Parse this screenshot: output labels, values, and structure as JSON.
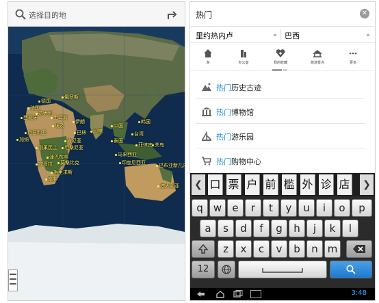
{
  "left": {
    "search_placeholder": "选择目的地",
    "map_labels": [
      {
        "text": "俄罗斯",
        "id": "russia"
      },
      {
        "text": "德国",
        "id": "germany"
      },
      {
        "text": "法国",
        "id": "france"
      },
      {
        "text": "西班牙",
        "id": "spain"
      },
      {
        "text": "意大利",
        "id": "italy"
      },
      {
        "text": "土耳其",
        "id": "turkey"
      },
      {
        "text": "伊朗",
        "id": "iran"
      },
      {
        "text": "埃及",
        "id": "egypt"
      },
      {
        "text": "印度",
        "id": "india"
      },
      {
        "text": "巴林",
        "id": "bahrain"
      },
      {
        "text": "中国",
        "id": "china"
      },
      {
        "text": "韩国",
        "id": "korea"
      },
      {
        "text": "台湾",
        "id": "taiwan"
      },
      {
        "text": "泰国",
        "id": "thailand"
      },
      {
        "text": "菲律宾",
        "id": "philippines"
      },
      {
        "text": "马来西亚",
        "id": "malaysia"
      },
      {
        "text": "印度尼西亚",
        "id": "indonesia"
      },
      {
        "text": "关岛",
        "id": "guam"
      },
      {
        "text": "巴布亚新几内",
        "id": "png"
      },
      {
        "text": "肯尼亚",
        "id": "kenya"
      },
      {
        "text": "坦桑尼亚",
        "id": "tanzania"
      },
      {
        "text": "刚果民主",
        "id": "drc"
      },
      {
        "text": "安哥拉",
        "id": "angola"
      },
      {
        "text": "莫桑比克",
        "id": "mozambique"
      },
      {
        "text": "津巴布韦",
        "id": "zimbabwe"
      },
      {
        "text": "南非",
        "id": "south-africa"
      },
      {
        "text": "毛里求斯",
        "id": "mauritius"
      },
      {
        "text": "澳大利亚",
        "id": "australia"
      },
      {
        "text": "尼日利亚",
        "id": "nigeria"
      },
      {
        "text": "加纳",
        "id": "ghana"
      }
    ]
  },
  "right": {
    "search_query": "热门",
    "location_city": "里约热内卢",
    "location_country": "巴西",
    "categories": [
      {
        "label": "家",
        "icon": "home-icon"
      },
      {
        "label": "办公室",
        "icon": "office-icon"
      },
      {
        "label": "我的收藏",
        "icon": "favorite-icon"
      },
      {
        "label": "旅游景点",
        "icon": "attraction-icon"
      },
      {
        "label": "更多",
        "icon": "more-icon"
      }
    ],
    "results": [
      {
        "highlight": "热门",
        "rest": "历史古迹",
        "icon": "mountain-icon"
      },
      {
        "highlight": "热门",
        "rest": "博物馆",
        "icon": "museum-icon"
      },
      {
        "highlight": "热门",
        "rest": "游乐园",
        "icon": "amusement-icon"
      },
      {
        "highlight": "热门",
        "rest": "购物中心",
        "icon": "cart-icon"
      }
    ],
    "keyboard": {
      "candidates": [
        "口",
        "票",
        "户",
        "前",
        "槛",
        "外",
        "诊",
        "店"
      ],
      "row1": [
        "q",
        "w",
        "e",
        "r",
        "t",
        "y",
        "u",
        "i",
        "o",
        "p"
      ],
      "row2": [
        "a",
        "s",
        "d",
        "f",
        "g",
        "h",
        "j",
        "k",
        "l"
      ],
      "row3": [
        "z",
        "x",
        "c",
        "v",
        "b",
        "n",
        "m"
      ],
      "numbers_label": "12",
      "left_arrow": "❮",
      "right_arrow": "❯"
    },
    "status": {
      "time": "3:48"
    }
  }
}
